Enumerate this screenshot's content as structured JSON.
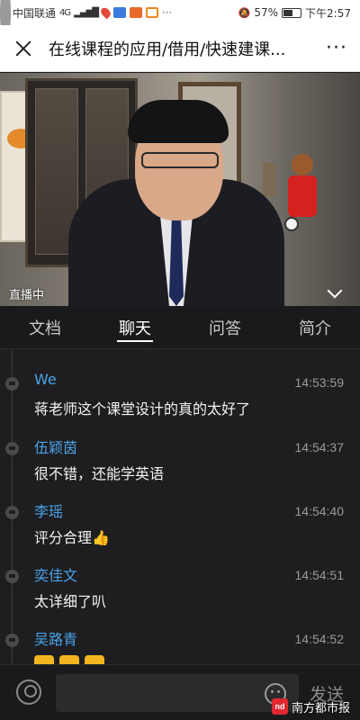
{
  "status_bar": {
    "carrier": "中国联通",
    "network": "4G",
    "battery": "57%",
    "battery_level": 0.57,
    "time": "下午2:57",
    "icons": [
      "signal-icon",
      "wifi-icon",
      "message-icon",
      "location-icon",
      "app-icon",
      "app-icon",
      "app-icon",
      "more-dots-icon",
      "mute-icon",
      "battery-icon"
    ]
  },
  "header": {
    "close_icon": "close-icon",
    "title": "在线课程的应用/借用/快速建课...",
    "more_icon": "more-icon"
  },
  "video": {
    "live_label": "直播中",
    "collapse_icon": "chevron-down-icon"
  },
  "tabs": [
    {
      "label": "文档",
      "active": false
    },
    {
      "label": "聊天",
      "active": true
    },
    {
      "label": "问答",
      "active": false
    },
    {
      "label": "简介",
      "active": false
    }
  ],
  "messages": [
    {
      "name": "We",
      "time": "14:53:59",
      "text": "蒋老师这个课堂设计的真的太好了"
    },
    {
      "name": "伍颖茵",
      "time": "14:54:37",
      "text": "很不错，还能学英语"
    },
    {
      "name": "李瑶",
      "time": "14:54:40",
      "text": "评分合理👍"
    },
    {
      "name": "奕佳文",
      "time": "14:54:51",
      "text": "太详细了叭"
    },
    {
      "name": "吴路青",
      "time": "14:54:52",
      "text": ""
    }
  ],
  "input_bar": {
    "user_icon": "user-icon",
    "placeholder": "",
    "emoji_icon": "emoji-icon",
    "send_label": "发送"
  },
  "watermark": {
    "logo": "nd",
    "text": "南方都市报"
  }
}
